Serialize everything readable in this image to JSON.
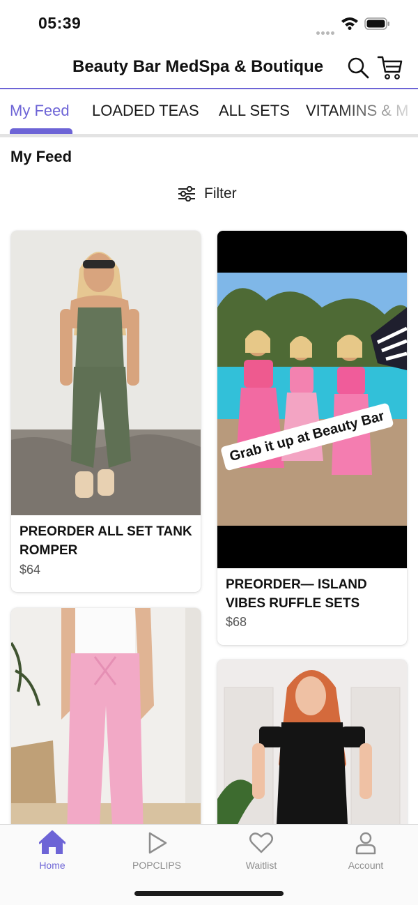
{
  "status_bar": {
    "time": "05:39",
    "icons": [
      "signal-dots-icon",
      "wifi-icon",
      "battery-icon"
    ]
  },
  "header": {
    "title": "Beauty Bar MedSpa & Boutique",
    "search_icon": "search-icon",
    "cart_icon": "cart-icon"
  },
  "tabs": {
    "items": [
      {
        "label": "My Feed",
        "active": true
      },
      {
        "label": "LOADED TEAS",
        "active": false
      },
      {
        "label": "ALL SETS",
        "active": false
      },
      {
        "label": "VITAMINS & M",
        "active": false
      }
    ]
  },
  "feed": {
    "section_title": "My Feed",
    "filter_label": "Filter",
    "filter_icon": "sliders-icon",
    "products": [
      {
        "name": "PREORDER ALL SET TANK ROMPER",
        "price": "$64"
      },
      {
        "name": "PREORDER— ISLAND VIBES RUFFLE SETS",
        "price": "$68",
        "photo_caption": "Grab it up at Beauty Bar"
      },
      {
        "name": "",
        "price": ""
      },
      {
        "name": "",
        "price": ""
      }
    ]
  },
  "bottom_nav": {
    "items": [
      {
        "label": "Home",
        "icon": "home-icon",
        "active": true
      },
      {
        "label": "POPCLIPS",
        "icon": "play-icon",
        "active": false
      },
      {
        "label": "Waitlist",
        "icon": "heart-icon",
        "active": false
      },
      {
        "label": "Account",
        "icon": "person-icon",
        "active": false
      }
    ]
  },
  "colors": {
    "accent": "#6d64d6",
    "text": "#111111",
    "muted": "#8d8d8d",
    "divider": "#e3e3e3"
  }
}
